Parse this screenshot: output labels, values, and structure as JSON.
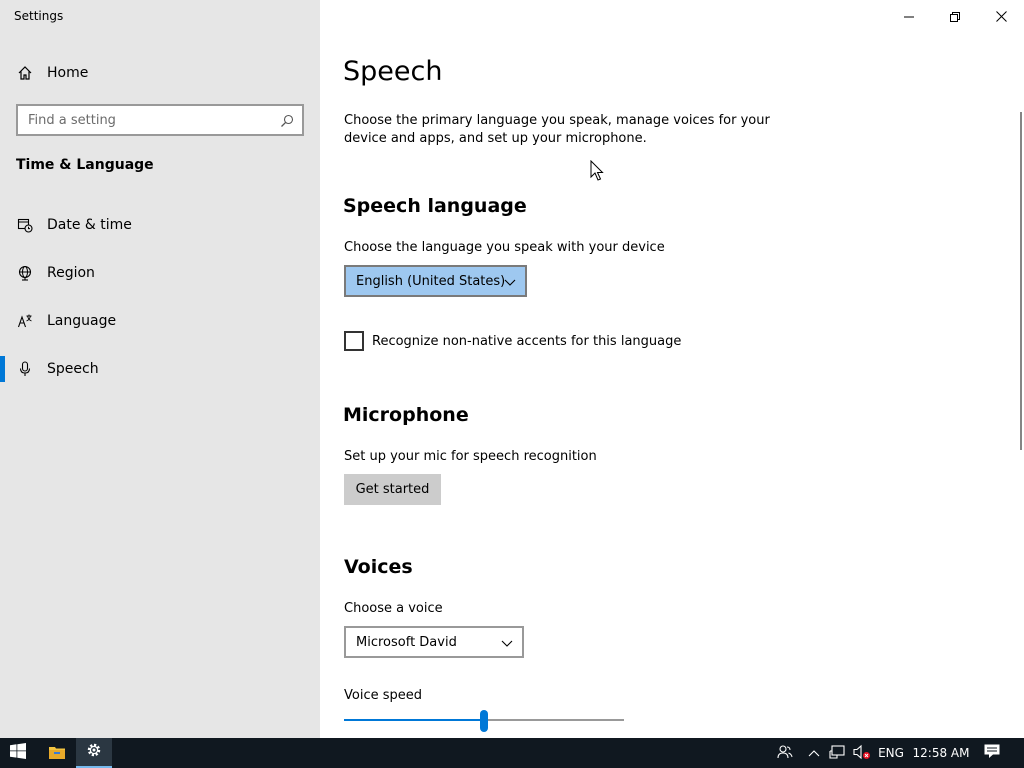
{
  "window": {
    "title": "Settings",
    "controls": {
      "minimize_icon": "minimize-icon",
      "restore_icon": "restore-icon",
      "close_icon": "close-icon"
    }
  },
  "sidebar": {
    "home_label": "Home",
    "search": {
      "placeholder": "Find a setting",
      "value": ""
    },
    "section_heading": "Time & Language",
    "items": [
      {
        "label": "Date & time",
        "icon": "calendar-clock-icon",
        "selected": false
      },
      {
        "label": "Region",
        "icon": "globe-icon",
        "selected": false
      },
      {
        "label": "Language",
        "icon": "language-icon",
        "selected": false
      },
      {
        "label": "Speech",
        "icon": "microphone-icon",
        "selected": true
      }
    ]
  },
  "main": {
    "title": "Speech",
    "intro": "Choose the primary language you speak, manage voices for your device and apps, and set up your microphone.",
    "speech_language": {
      "heading": "Speech language",
      "label": "Choose the language you speak with your device",
      "selected": "English (United States)",
      "checkbox_label": "Recognize non-native accents for this language",
      "checkbox_checked": false
    },
    "microphone": {
      "heading": "Microphone",
      "label": "Set up your mic for speech recognition",
      "button_label": "Get started"
    },
    "voices": {
      "heading": "Voices",
      "choose_label": "Choose a voice",
      "selected_voice": "Microsoft David",
      "speed_label": "Voice speed",
      "speed_fraction": 0.5
    }
  },
  "taskbar": {
    "language": "ENG",
    "time": "12:58 AM",
    "icons": [
      "start-icon",
      "file-explorer-icon",
      "settings-icon",
      "people-icon",
      "chevron-up-icon",
      "network-icon",
      "volume-muted-icon",
      "notifications-icon"
    ]
  },
  "colors": {
    "accent": "#0078d7",
    "sidebar_bg": "#e6e6e6",
    "taskbar_bg": "#101820",
    "dropdown_active": "#9ec8f0"
  }
}
